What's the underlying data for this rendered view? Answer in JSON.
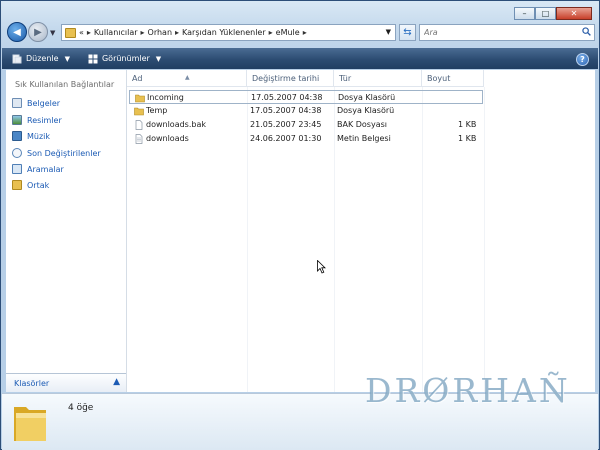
{
  "window": {
    "caption_buttons": {
      "minimize": "–",
      "maximize": "□",
      "close": "✕"
    }
  },
  "nav": {
    "breadcrumb": [
      "Kullanıcılar",
      "Orhan",
      "Karşıdan Yüklenenler",
      "eMule"
    ],
    "overflow": "«",
    "search_placeholder": "Ara"
  },
  "toolbar": {
    "organize_label": "Düzenle",
    "views_label": "Görünümler",
    "help_label": "?"
  },
  "navpane": {
    "title": "Sık Kullanılan Bağlantılar",
    "items": [
      {
        "label": "Belgeler",
        "icon": "documents-icon"
      },
      {
        "label": "Resimler",
        "icon": "pictures-icon"
      },
      {
        "label": "Müzik",
        "icon": "music-icon"
      },
      {
        "label": "Son Değiştirilenler",
        "icon": "recent-icon"
      },
      {
        "label": "Aramalar",
        "icon": "searches-icon"
      },
      {
        "label": "Ortak",
        "icon": "public-folder-icon"
      }
    ],
    "folders_label": "Klasörler"
  },
  "columns": {
    "name": "Ad",
    "date": "Değiştirme tarihi",
    "type": "Tür",
    "size": "Boyut"
  },
  "files": [
    {
      "name": "Incoming",
      "date": "17.05.2007 04:38",
      "type": "Dosya Klasörü",
      "size": "",
      "icon": "folder-icon",
      "selected": true
    },
    {
      "name": "Temp",
      "date": "17.05.2007 04:38",
      "type": "Dosya Klasörü",
      "size": "",
      "icon": "folder-icon",
      "selected": false
    },
    {
      "name": "downloads.bak",
      "date": "21.05.2007 23:45",
      "type": "BAK Dosyası",
      "size": "1 KB",
      "icon": "file-icon",
      "selected": false
    },
    {
      "name": "downloads",
      "date": "24.06.2007 01:30",
      "type": "Metin Belgesi",
      "size": "1 KB",
      "icon": "text-file-icon",
      "selected": false
    }
  ],
  "details": {
    "item_count": "4 öğe"
  },
  "watermark": "DRØRHAÑ",
  "colors": {
    "link": "#1c5bb4",
    "toolbar": "#2c4c72",
    "folder": "#e8c050"
  }
}
